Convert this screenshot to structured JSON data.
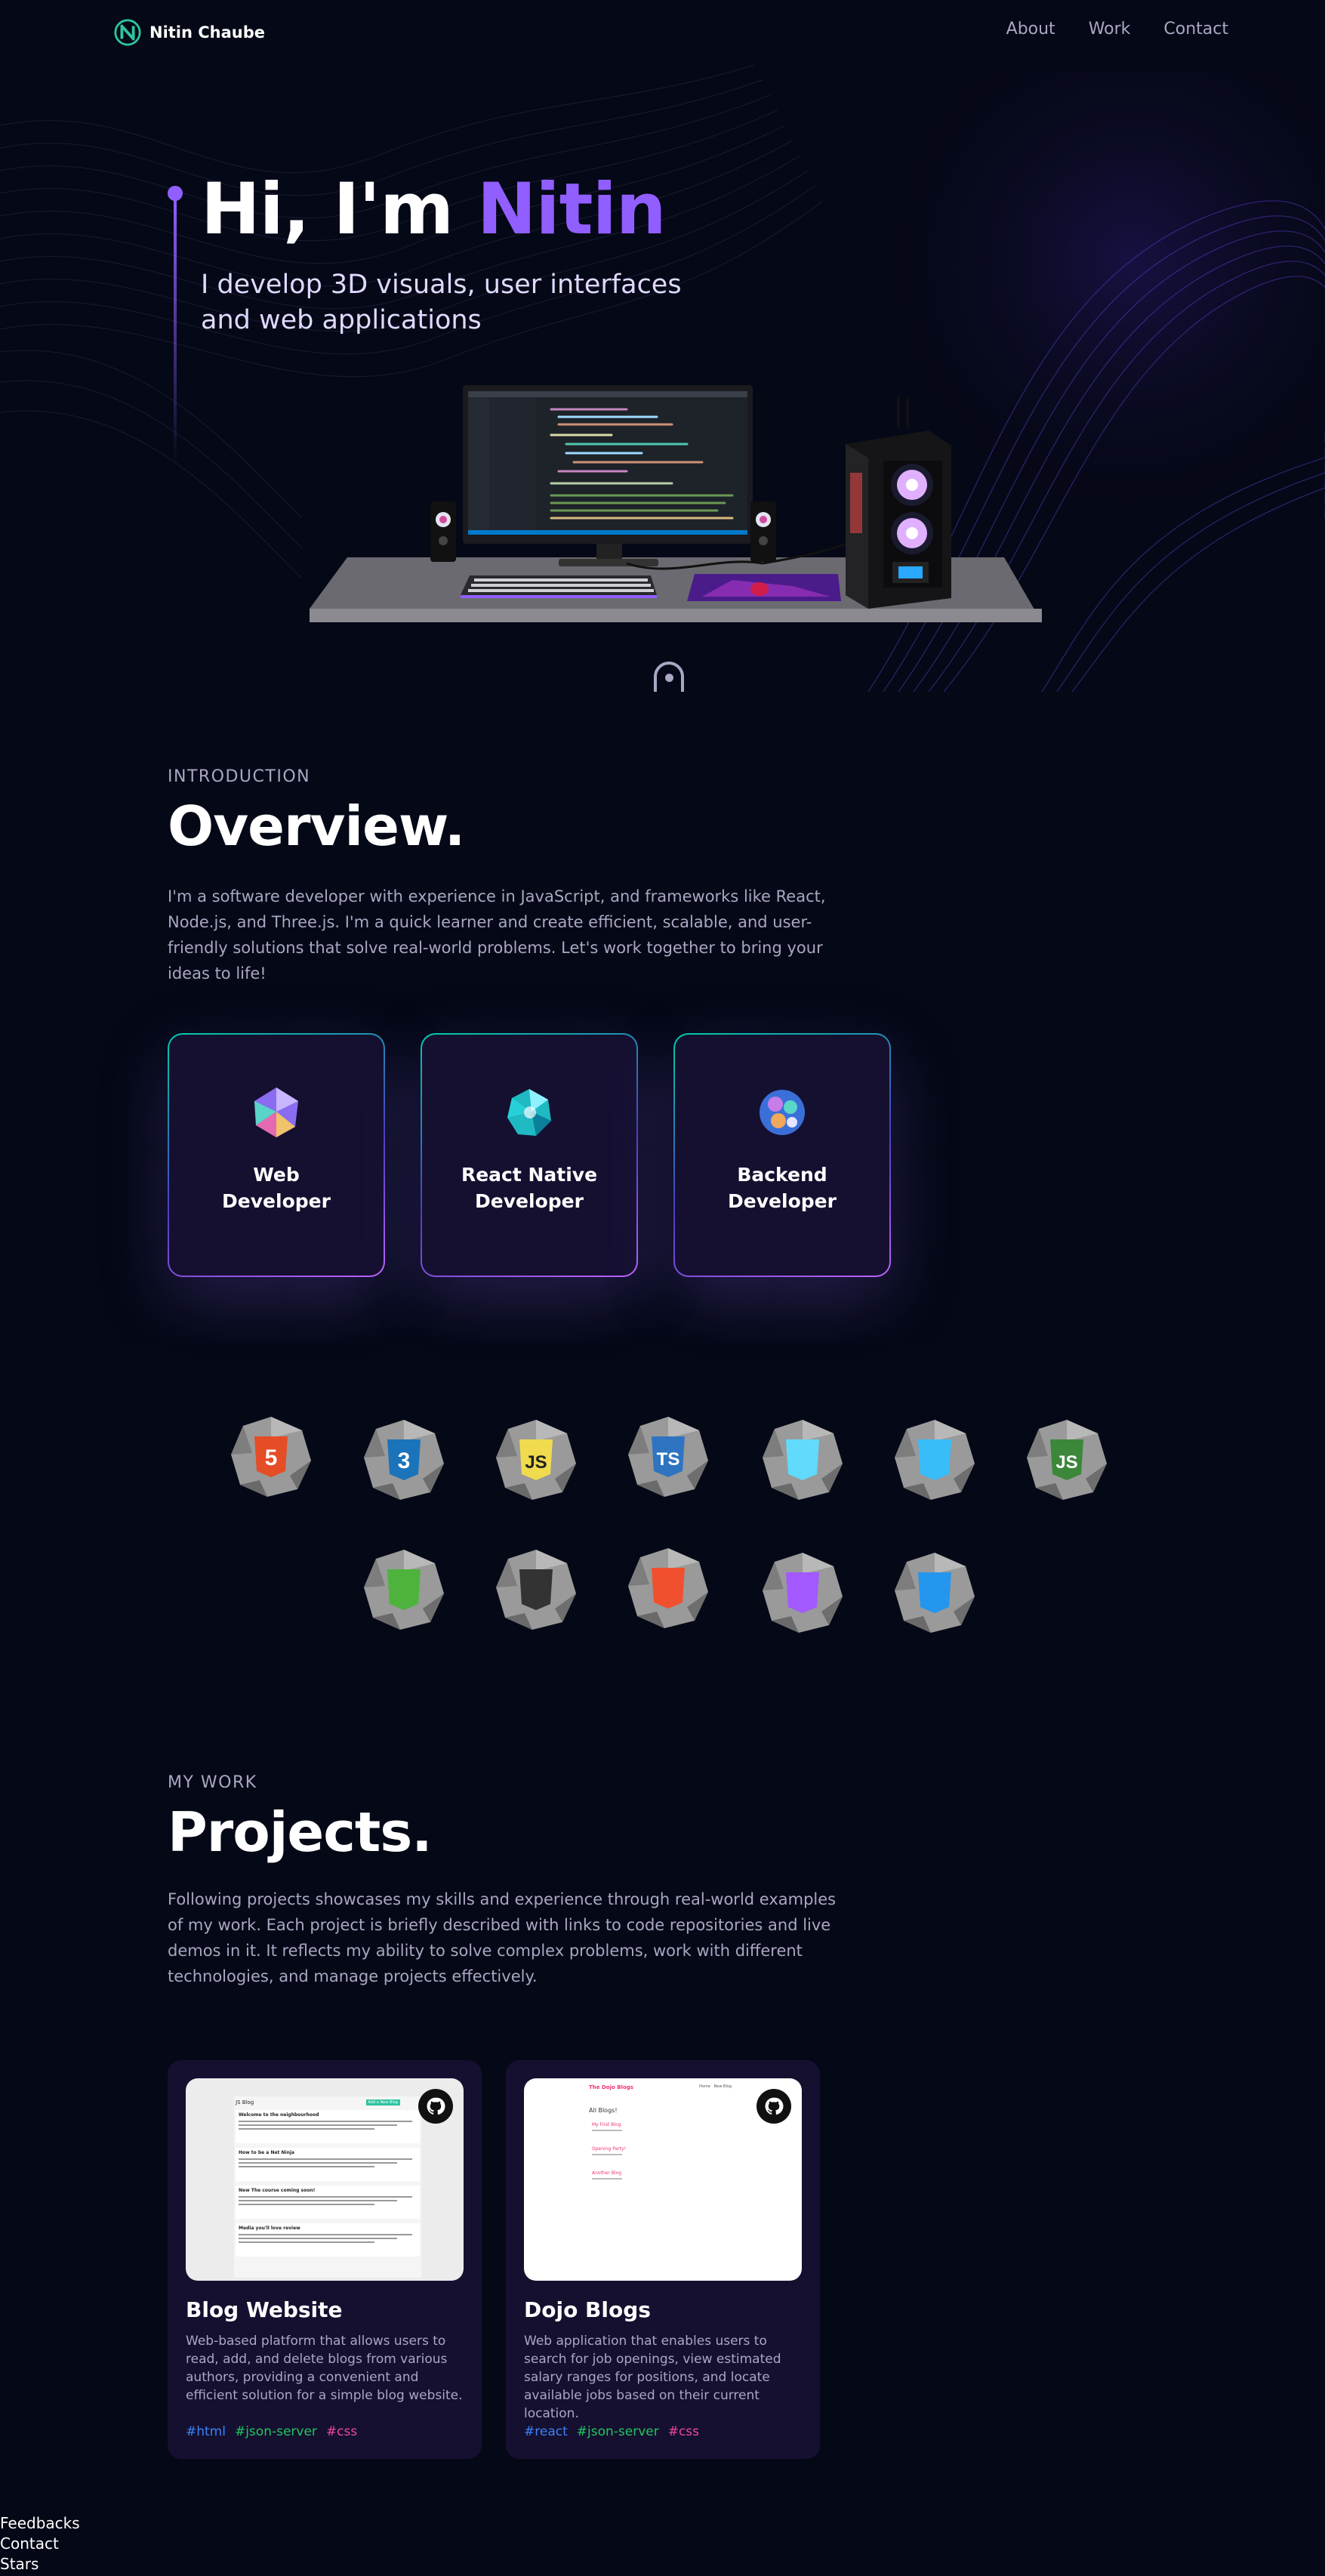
{
  "nav": {
    "brand": "Nitin Chaube",
    "links": [
      "About",
      "Work",
      "Contact"
    ]
  },
  "hero": {
    "greeting": "Hi, I'm ",
    "name": "Nitin",
    "subtitle": "I develop 3D visuals, user interfaces and web applications"
  },
  "overview": {
    "subtitle": "INTRODUCTION",
    "heading": "Overview.",
    "text": "I'm a software developer with experience in JavaScript, and frameworks like React, Node.js, and Three.js. I'm a quick learner and create efficient, scalable, and user-friendly solutions that solve real-world problems. Let's work together to bring your ideas to life!",
    "services": [
      {
        "title": "Web Developer"
      },
      {
        "title": "React Native Developer"
      },
      {
        "title": "Backend Developer"
      }
    ]
  },
  "tech": [
    {
      "label": "5",
      "icon": "html5-icon",
      "color": "#e44d26"
    },
    {
      "label": "3",
      "icon": "css3-icon",
      "color": "#1b73ba"
    },
    {
      "label": "JS",
      "icon": "javascript-icon",
      "color": "#f0db4f"
    },
    {
      "label": "TS",
      "icon": "typescript-icon",
      "color": "#2f74c0"
    },
    {
      "label": "",
      "icon": "react-icon",
      "color": "#61dafb"
    },
    {
      "label": "",
      "icon": "tailwind-icon",
      "color": "#38bdf8"
    },
    {
      "label": "JS",
      "icon": "nodejs-icon",
      "color": "#3c873a"
    },
    {
      "label": "",
      "icon": "mongodb-icon",
      "color": "#4db33d"
    },
    {
      "label": "",
      "icon": "threejs-icon",
      "color": "#333333"
    },
    {
      "label": "",
      "icon": "git-icon",
      "color": "#f1502f"
    },
    {
      "label": "",
      "icon": "figma-icon",
      "color": "#a259ff"
    },
    {
      "label": "",
      "icon": "docker-icon",
      "color": "#2496ed"
    }
  ],
  "work": {
    "subtitle": "MY WORK",
    "heading": "Projects.",
    "text": "Following projects showcases my skills and experience through real-world examples of my work. Each project is briefly described with links to code repositories and live demos in it. It reflects my ability to solve complex problems, work with different technologies, and manage projects effectively.",
    "projects": [
      {
        "title": "Blog Website",
        "description": "Web-based platform that allows users to read, add, and delete blogs from various authors, providing a convenient and efficient solution for a simple blog website.",
        "tags": [
          {
            "name": "#html",
            "color": "#3b82f6"
          },
          {
            "name": "#json-server",
            "color": "#22c55e"
          },
          {
            "name": "#css",
            "color": "#ec4899"
          }
        ],
        "screenshot": {
          "header": "JS Blog",
          "button": "Add a New Blog",
          "posts": [
            "Welcome to the neighbourhood",
            "How to be a Net Ninja",
            "New The course coming soon!",
            "Media you'll love review"
          ]
        }
      },
      {
        "title": "Dojo Blogs",
        "description": "Web application that enables users to search for job openings, view estimated salary ranges for positions, and locate available jobs based on their current location.",
        "tags": [
          {
            "name": "#react",
            "color": "#3b82f6"
          },
          {
            "name": "#json-server",
            "color": "#22c55e"
          },
          {
            "name": "#css",
            "color": "#ec4899"
          }
        ],
        "screenshot": {
          "header": "The Dojo Blogs",
          "nav": "Home   New Blog",
          "list_title": "All Blogs!",
          "posts": [
            "My First Blog",
            "Opening Party!",
            "Another Blog"
          ]
        }
      }
    ]
  },
  "footer": [
    "Feedbacks",
    "Contact",
    "Stars"
  ]
}
